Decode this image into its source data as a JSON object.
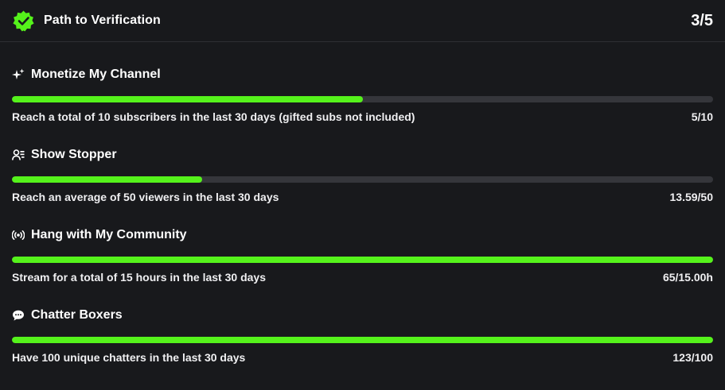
{
  "header": {
    "title": "Path to Verification",
    "progress": "3/5",
    "badge_icon": "verified-badge-icon",
    "accent_color": "#55f21b"
  },
  "goals": [
    {
      "icon": "sparkle-icon",
      "title": "Monetize My Channel",
      "description": "Reach a total of 10 subscribers in the last 30 days (gifted subs not included)",
      "value": "5/10",
      "progress_fraction": 0.5
    },
    {
      "icon": "viewers-icon",
      "title": "Show Stopper",
      "description": "Reach an average of 50 viewers in the last 30 days",
      "value": "13.59/50",
      "progress_fraction": 0.2718
    },
    {
      "icon": "broadcast-icon",
      "title": "Hang with My Community",
      "description": "Stream for a total of 15 hours in the last 30 days",
      "value": "65/15.00h",
      "progress_fraction": 1.0
    },
    {
      "icon": "chat-bubble-icon",
      "title": "Chatter Boxers",
      "description": "Have 100 unique chatters in the last 30 days",
      "value": "123/100",
      "progress_fraction": 1.0
    }
  ],
  "colors": {
    "background": "#18191c",
    "track": "#35363b",
    "fill": "#55f21b",
    "text": "#ffffff"
  }
}
